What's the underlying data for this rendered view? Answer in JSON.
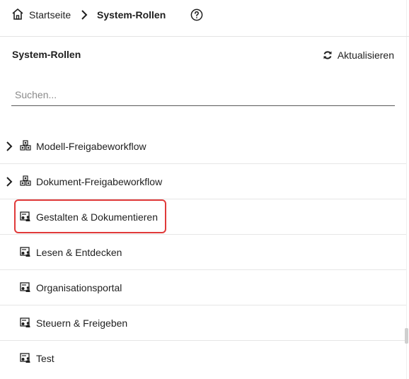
{
  "breadcrumb": {
    "home_label": "Startseite",
    "current_label": "System-Rollen"
  },
  "panel": {
    "title": "System-Rollen",
    "refresh_label": "Aktualisieren"
  },
  "search": {
    "placeholder": "Suchen...",
    "value": ""
  },
  "roles": [
    {
      "label": "Modell-Freigabeworkflow",
      "icon": "role-group-icon",
      "expandable": true
    },
    {
      "label": "Dokument-Freigabeworkflow",
      "icon": "role-group-icon",
      "expandable": true
    },
    {
      "label": "Gestalten & Dokumentieren",
      "icon": "role-icon",
      "expandable": false,
      "highlighted": true
    },
    {
      "label": "Lesen & Entdecken",
      "icon": "role-icon",
      "expandable": false
    },
    {
      "label": "Organisationsportal",
      "icon": "role-icon",
      "expandable": false
    },
    {
      "label": "Steuern & Freigeben",
      "icon": "role-icon",
      "expandable": false
    },
    {
      "label": "Test",
      "icon": "role-icon",
      "expandable": false
    }
  ],
  "colors": {
    "highlight_border": "#e03a3a",
    "text": "#1f1f1f",
    "divider": "#e6e6e6"
  }
}
